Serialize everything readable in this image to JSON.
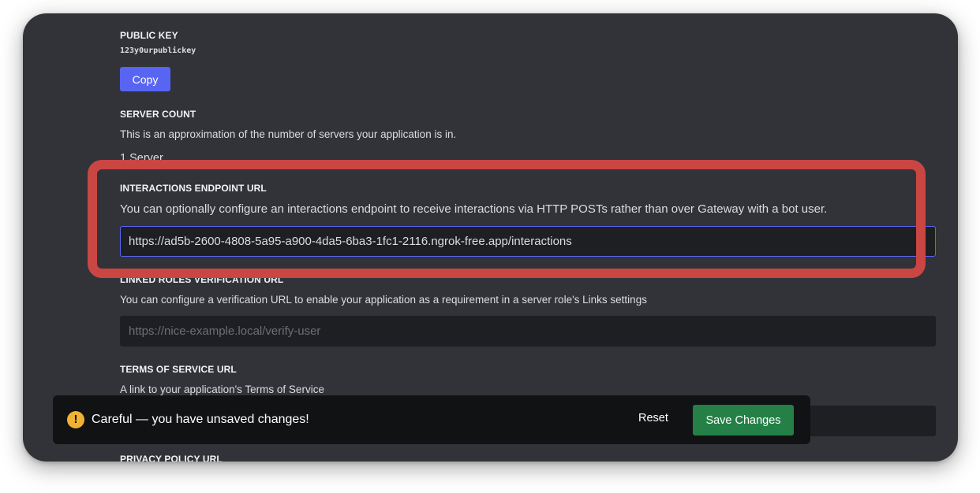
{
  "public_key": {
    "label": "PUBLIC KEY",
    "value": "123y0urpublickey",
    "copy_label": "Copy"
  },
  "server_count": {
    "label": "SERVER COUNT",
    "description": "This is an approximation of the number of servers your application is in.",
    "value": "1 Server"
  },
  "interactions_endpoint": {
    "label": "INTERACTIONS ENDPOINT URL",
    "description": "You can optionally configure an interactions endpoint to receive interactions via HTTP POSTs rather than over Gateway with a bot user.",
    "value": "https://ad5b-2600-4808-5a95-a900-4da5-6ba3-1fc1-2116.ngrok-free.app/interactions"
  },
  "linked_roles": {
    "label": "LINKED ROLES VERIFICATION URL",
    "description": "You can configure a verification URL to enable your application as a requirement in a server role's Links settings",
    "placeholder": "https://nice-example.local/verify-user"
  },
  "terms_of_service": {
    "label": "TERMS OF SERVICE URL",
    "description": "A link to your application's Terms of Service"
  },
  "privacy_policy": {
    "label": "PRIVACY POLICY URL"
  },
  "unsaved_bar": {
    "icon": "warning-icon",
    "message": "Careful — you have unsaved changes!",
    "reset_label": "Reset",
    "save_label": "Save Changes"
  },
  "colors": {
    "background": "#313338",
    "input_background": "#1e1f22",
    "primary_button": "#5865f2",
    "save_button": "#248046",
    "highlight_outline": "#c94643",
    "warning": "#f0b232"
  }
}
